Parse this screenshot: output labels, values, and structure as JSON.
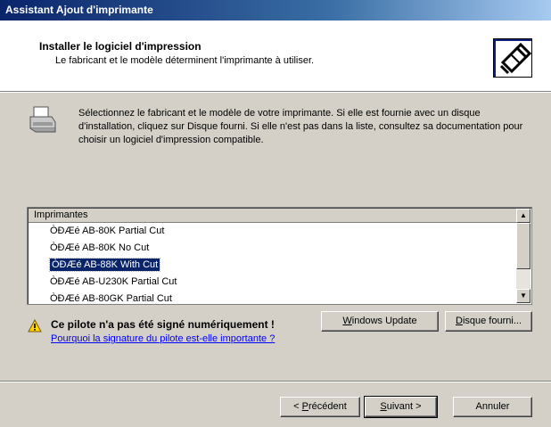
{
  "window": {
    "title": "Assistant Ajout d'imprimante"
  },
  "header": {
    "title": "Installer le logiciel d'impression",
    "subtitle": "Le fabricant et le modèle déterminent l'imprimante à utiliser.",
    "icon": "printer-wizard-icon"
  },
  "intro": {
    "icon": "printer-icon",
    "text": "Sélectionnez le fabricant et le modèle de votre imprimante. Si elle est fournie avec un disque d'installation, cliquez sur Disque fourni. Si elle n'est pas dans la liste, consultez sa documentation pour choisir un logiciel d'impression compatible."
  },
  "printers": {
    "header": "Imprimantes",
    "items": [
      {
        "label": "ÒÐÆé AB-80K Partial Cut",
        "selected": false
      },
      {
        "label": "ÒÐÆé AB-80K No Cut",
        "selected": false
      },
      {
        "label": "ÒÐÆé AB-88K With Cut",
        "selected": true
      },
      {
        "label": "ÒÐÆé AB-U230K Partial Cut",
        "selected": false
      },
      {
        "label": "ÒÐÆé AB-80GK Partial Cut",
        "selected": false
      }
    ]
  },
  "warning": {
    "icon": "warning-icon",
    "text": "Ce pilote n'a pas été signé numériquement !",
    "link": "Pourquoi la signature du pilote est-elle importante ?"
  },
  "buttons": {
    "windows_update": {
      "prefix": "",
      "key": "W",
      "rest": "indows Update"
    },
    "have_disk": {
      "prefix": "",
      "key": "D",
      "rest": "isque fourni..."
    },
    "back": {
      "prefix": "< ",
      "key": "P",
      "rest": "récédent"
    },
    "next": {
      "prefix": "",
      "key": "S",
      "rest": "uivant >"
    },
    "cancel": "Annuler"
  },
  "colors": {
    "selection": "#0a246a",
    "link": "#0000ff",
    "title_bar": "#0a246a"
  }
}
